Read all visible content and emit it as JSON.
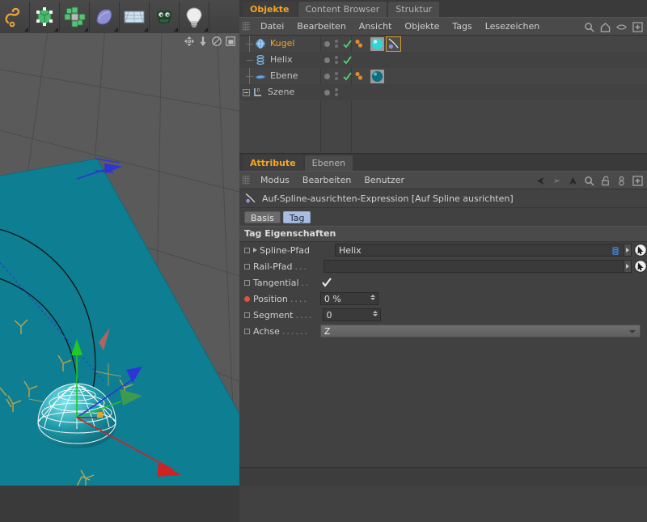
{
  "toolbar": {
    "tools": [
      {
        "name": "spline-tool-icon",
        "label": "Spline"
      },
      {
        "name": "cube-object-icon",
        "label": "Grundobjekt"
      },
      {
        "name": "array-object-icon",
        "label": "Modeling-Objekt"
      },
      {
        "name": "deformer-icon",
        "label": "Deformer"
      },
      {
        "name": "environment-icon",
        "label": "Szene"
      },
      {
        "name": "camera-icon",
        "label": "Kamera"
      },
      {
        "name": "light-icon",
        "label": "Licht"
      }
    ]
  },
  "viewport": {
    "nav_icons": [
      {
        "name": "move-camera-icon",
        "label": "Kamera verschieben"
      },
      {
        "name": "dolly-camera-icon",
        "label": "Kamera zoomen"
      },
      {
        "name": "rotate-camera-icon",
        "label": "Kamera drehen"
      },
      {
        "name": "maximize-view-icon",
        "label": "Ansicht maximieren"
      }
    ],
    "scene": {
      "ground_color": "#5a5a5a",
      "plane_color": "#0e7f93",
      "axis_x_color": "#cf2222",
      "axis_y_color": "#22c922",
      "axis_z_color": "#2b35d8",
      "spline_color": "#111111",
      "tangent_marker_color": "#c9a646",
      "object_wire_color": "#ffffff"
    }
  },
  "object_manager": {
    "tabs": [
      {
        "label": "Objekte",
        "active": true
      },
      {
        "label": "Content Browser",
        "active": false
      },
      {
        "label": "Struktur",
        "active": false
      }
    ],
    "menu": [
      "Datei",
      "Bearbeiten",
      "Ansicht",
      "Objekte",
      "Tags",
      "Lesezeichen"
    ],
    "menu_icons": [
      {
        "name": "search-icon"
      },
      {
        "name": "home-icon"
      },
      {
        "name": "eye-icon"
      },
      {
        "name": "plus-box-icon"
      }
    ],
    "rows": [
      {
        "label": "Kugel",
        "icon": "sphere-object-icon",
        "selected": true,
        "child": true,
        "expander": false,
        "visible_dot": true,
        "enabled_check": true,
        "tags": [
          {
            "name": "material-tag-icon",
            "selected": false
          },
          {
            "name": "align-to-spline-tag-icon",
            "selected": true
          }
        ]
      },
      {
        "label": "Helix",
        "icon": "helix-spline-icon",
        "selected": false,
        "child": true,
        "expander": false,
        "visible_dot": true,
        "enabled_check": true,
        "tags": []
      },
      {
        "label": "Ebene",
        "icon": "plane-object-icon",
        "selected": false,
        "child": true,
        "expander": false,
        "visible_dot": true,
        "enabled_check": true,
        "tags": [
          {
            "name": "material-tag-icon",
            "selected": false
          }
        ]
      },
      {
        "label": "Szene",
        "icon": "scene-axis-icon",
        "selected": false,
        "child": false,
        "expander": true,
        "visible_dot": true,
        "enabled_check": false,
        "tags": []
      }
    ]
  },
  "attribute_manager": {
    "tabs": [
      {
        "label": "Attribute",
        "active": true
      },
      {
        "label": "Ebenen",
        "active": false
      }
    ],
    "menu": [
      "Modus",
      "Bearbeiten",
      "Benutzer"
    ],
    "menu_icons": [
      {
        "name": "back-arrow-icon"
      },
      {
        "name": "forward-arrow-icon-disabled"
      },
      {
        "name": "up-arrow-icon"
      },
      {
        "name": "search-icon"
      },
      {
        "name": "lock-icon"
      },
      {
        "name": "link-icon"
      },
      {
        "name": "plus-box-icon"
      }
    ],
    "expression_icon": "align-to-spline-tag-icon",
    "expression_title": "Auf-Spline-ausrichten-Expression [Auf Spline ausrichten]",
    "segments": [
      {
        "label": "Basis",
        "active": false
      },
      {
        "label": "Tag",
        "active": true
      }
    ],
    "group_header": "Tag Eigenschaften",
    "properties": [
      {
        "label": "Spline-Pfad",
        "dots": "",
        "type": "link",
        "value": "Helix",
        "value_icon": "helix-spline-icon",
        "marker": "square",
        "has_triangle": true,
        "has_picker": true
      },
      {
        "label": "Rail-Pfad",
        "dots": "...",
        "type": "link",
        "value": "",
        "value_icon": "",
        "marker": "square",
        "has_triangle": false,
        "has_picker": true
      },
      {
        "label": "Tangential",
        "dots": "..",
        "type": "checkbox",
        "value": "checked",
        "marker": "square",
        "has_triangle": false,
        "has_picker": false
      },
      {
        "label": "Position",
        "dots": "....",
        "type": "number",
        "value": "0 %",
        "marker": "red-dot",
        "has_triangle": false,
        "has_picker": false
      },
      {
        "label": "Segment",
        "dots": "....",
        "type": "number",
        "value": "0",
        "marker": "square",
        "has_triangle": false,
        "has_picker": false
      },
      {
        "label": "Achse",
        "dots": "......",
        "type": "dropdown",
        "value": "Z",
        "marker": "square",
        "has_triangle": false,
        "has_picker": false
      }
    ]
  },
  "colors": {
    "accent_orange": "#f5a623",
    "panel_bg": "#414141",
    "toolbar_bg": "#4a4a4a",
    "selected_segment": "#a8bde0"
  }
}
